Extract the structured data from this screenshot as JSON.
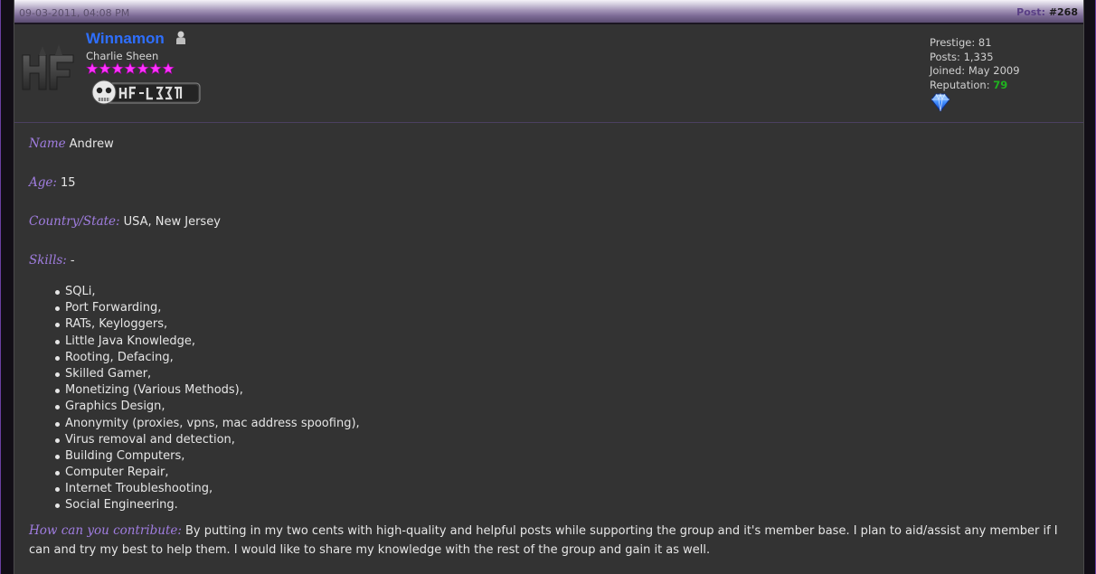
{
  "header": {
    "date": "09-03-2011, 04:08 PM",
    "post_label": "Post:",
    "post_number": "#268"
  },
  "author": {
    "username": "Winnamon",
    "title": "Charlie Sheen",
    "star_count": 7,
    "username_color": "#2e6fff",
    "star_color": "#ff33ff",
    "avatar_icon": "hf-logo-icon",
    "userbar_icon": "hf-l33t-userbar-icon",
    "status_icon": "offline-user-icon",
    "award_icon": "blue-diamond-award-icon"
  },
  "stats": {
    "prestige": "Prestige: 81",
    "posts": "Posts: 1,335",
    "joined": "Joined: May 2009",
    "reputation_label": "Reputation:",
    "reputation_value": "79"
  },
  "content": {
    "name_label": "Name",
    "name_value": "Andrew",
    "age_label": "Age:",
    "age_value": "15",
    "country_label": "Country/State:",
    "country_value": "USA, New Jersey",
    "skills_label": "Skills:",
    "skills_value": "-",
    "skills": [
      "SQLi,",
      "Port Forwarding,",
      "RATs, Keyloggers,",
      "Little Java Knowledge,",
      "Rooting, Defacing,",
      "Skilled Gamer,",
      "Monetizing (Various Methods),",
      "Graphics Design,",
      "Anonymity (proxies, vpns, mac address spoofing),",
      "Virus removal and detection,",
      "Building Computers,",
      "Computer Repair,",
      "Internet Troubleshooting,",
      "Social Engineering."
    ],
    "contrib_label": "How can you contribute:",
    "contrib_value": "By putting in my two cents with high-quality and helpful posts while supporting the group and it's member base. I plan to aid/assist any member if I can and try my best to help them. I would like to share my knowledge with the rest of the group and gain it as well."
  }
}
